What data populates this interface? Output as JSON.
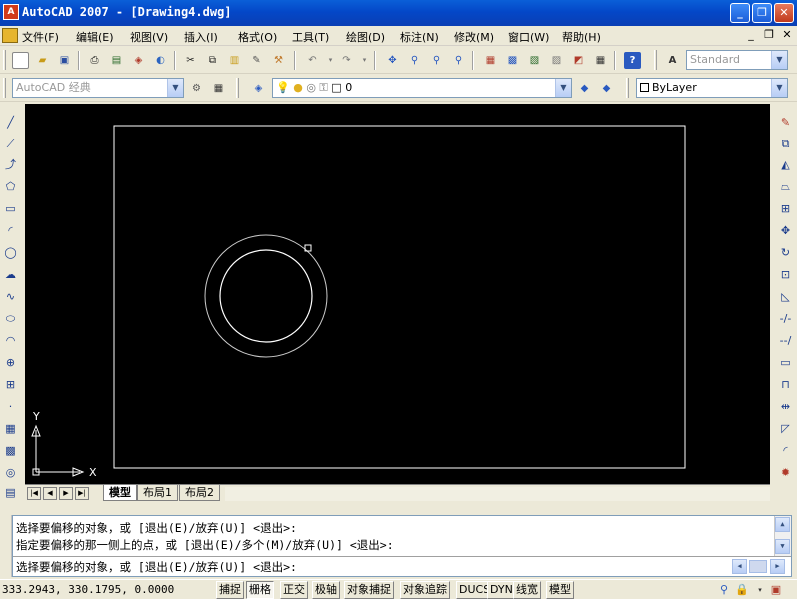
{
  "titlebar": {
    "title": "AutoCAD 2007 - [Drawing4.dwg]",
    "icon": "autocad-logo-icon",
    "minimize": "_",
    "restore": "❐",
    "close": "✕"
  },
  "menubar": {
    "items": [
      "文件(F)",
      "编辑(E)",
      "视图(V)",
      "插入(I)",
      "格式(O)",
      "工具(T)",
      "绘图(D)",
      "标注(N)",
      "修改(M)",
      "窗口(W)",
      "帮助(H)"
    ],
    "doc_minimize": "_",
    "doc_restore": "❐",
    "doc_close": "✕"
  },
  "toolbar": {
    "text_style": "Standard",
    "workspace": "AutoCAD 经典",
    "layer": "0",
    "color": "ByLayer"
  },
  "drawing": {
    "ucs_y": "Y",
    "ucs_x": "X",
    "background_color": "#000000",
    "entity_color": "#ffffff"
  },
  "tabs": {
    "items": [
      "模型",
      "布局1",
      "布局2"
    ],
    "active": "模型",
    "nav": [
      "|◀",
      "◀",
      "▶",
      "▶|"
    ]
  },
  "command": {
    "history": [
      "选择要偏移的对象，或 [退出(E)/放弃(U)] <退出>:",
      "指定要偏移的那一侧上的点，或 [退出(E)/多个(M)/放弃(U)] <退出>:"
    ],
    "prompt": "选择要偏移的对象，或 [退出(E)/放弃(U)] <退出>:"
  },
  "status": {
    "coords": "333.2943, 330.1795, 0.0000",
    "buttons": [
      {
        "label": "捕捉",
        "on": false
      },
      {
        "label": "栅格",
        "on": true
      },
      {
        "label": "正交",
        "on": false
      },
      {
        "label": "极轴",
        "on": false
      },
      {
        "label": "对象捕捉",
        "on": false
      },
      {
        "label": "对象追踪",
        "on": false
      },
      {
        "label": "DUCS",
        "on": false
      },
      {
        "label": "DYN",
        "on": false
      },
      {
        "label": "线宽",
        "on": false
      },
      {
        "label": "模型",
        "on": false
      }
    ]
  }
}
